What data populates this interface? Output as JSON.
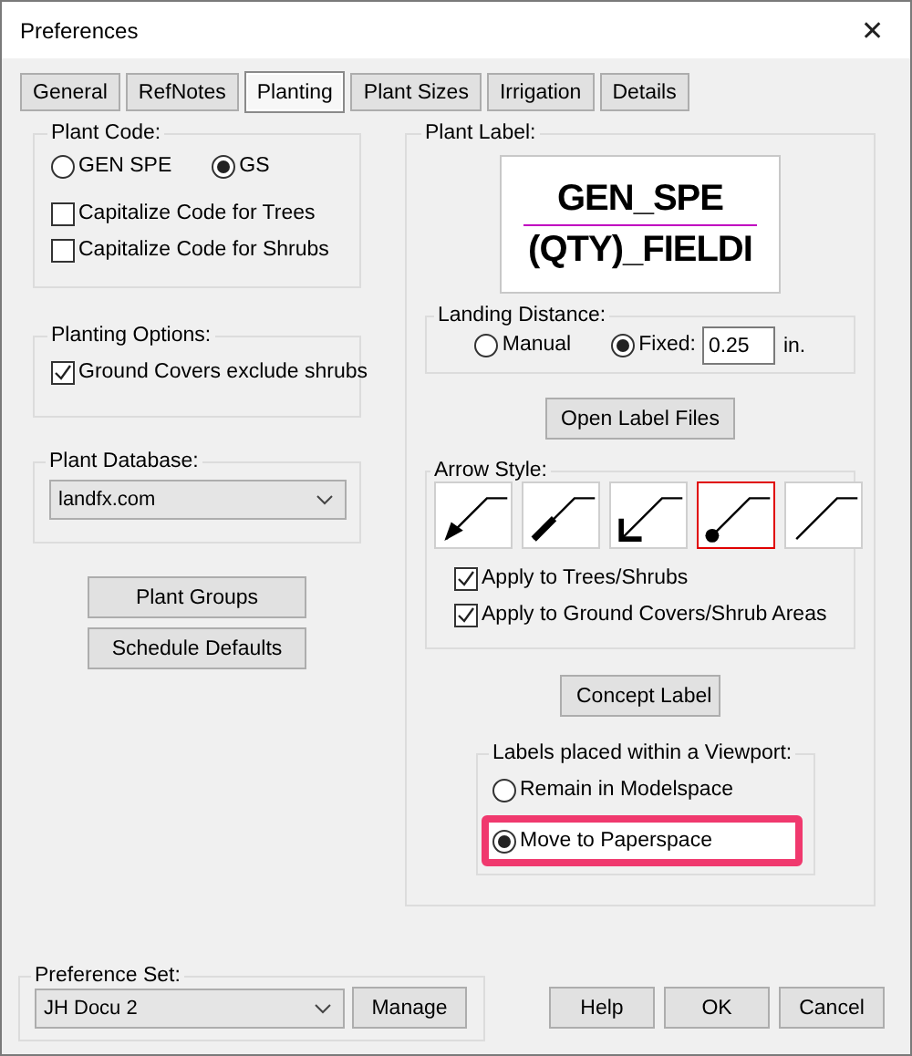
{
  "window": {
    "title": "Preferences",
    "close": "✕"
  },
  "tabs": [
    {
      "label": "General",
      "selected": false
    },
    {
      "label": "RefNotes",
      "selected": false
    },
    {
      "label": "Planting",
      "selected": true
    },
    {
      "label": "Plant Sizes",
      "selected": false
    },
    {
      "label": "Irrigation",
      "selected": false
    },
    {
      "label": "Details",
      "selected": false
    }
  ],
  "plant_code": {
    "title": "Plant Code:",
    "options": [
      {
        "label": "GEN SPE",
        "selected": false
      },
      {
        "label": "GS",
        "selected": true
      }
    ],
    "checkboxes": [
      {
        "label": "Capitalize Code for Trees",
        "checked": false
      },
      {
        "label": "Capitalize Code for Shrubs",
        "checked": false
      }
    ]
  },
  "planting_options": {
    "title": "Planting Options:",
    "checkboxes": [
      {
        "label": "Ground Covers exclude shrubs",
        "checked": true
      }
    ]
  },
  "plant_database": {
    "title": "Plant Database:",
    "value": "landfx.com"
  },
  "left_buttons": [
    "Plant Groups",
    "Schedule Defaults"
  ],
  "plant_label": {
    "title": "Plant Label:",
    "preview_lines": [
      "GEN_SPE",
      "(QTY)_FIELDI"
    ],
    "landing_distance": {
      "title": "Landing Distance:",
      "options": [
        {
          "label": "Manual",
          "selected": false
        },
        {
          "label": "Fixed:",
          "selected": true
        }
      ],
      "value": "0.25",
      "unit": "in."
    },
    "open_button": "Open Label Files",
    "arrow_style": {
      "title": "Arrow Style:",
      "styles": [
        {
          "kind": "filled",
          "selected": false
        },
        {
          "kind": "thick",
          "selected": false
        },
        {
          "kind": "open",
          "selected": false
        },
        {
          "kind": "dot",
          "selected": true
        },
        {
          "kind": "plain",
          "selected": false
        }
      ],
      "checkboxes": [
        {
          "label": "Apply to Trees/Shrubs",
          "checked": true
        },
        {
          "label": "Apply to Ground Covers/Shrub Areas",
          "checked": true
        }
      ]
    },
    "concept_button": "Concept Label",
    "viewport": {
      "title": "Labels placed within a Viewport:",
      "options": [
        {
          "label": "Remain in Modelspace",
          "selected": false,
          "highlighted": false
        },
        {
          "label": "Move to Paperspace",
          "selected": true,
          "highlighted": true
        }
      ]
    }
  },
  "preference_set": {
    "title": "Preference Set:",
    "value": "JH Docu 2",
    "button": "Manage"
  },
  "footer_buttons": [
    "Help",
    "OK",
    "Cancel"
  ]
}
